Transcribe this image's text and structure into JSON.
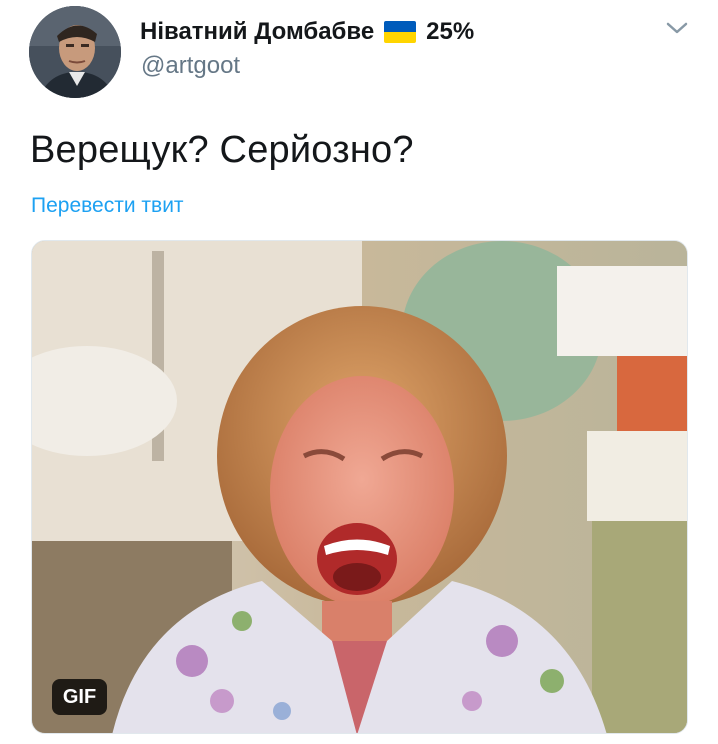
{
  "tweet": {
    "author": {
      "display_name": "Ніватний Домбабве",
      "flag_icon": "ukraine-flag-icon",
      "percent": "25%",
      "handle": "@artgoot"
    },
    "text": "Верещук? Серйозно?",
    "translate_label": "Перевести твит",
    "media": {
      "badge": "GIF",
      "description_icon": "laughing-woman-gif"
    },
    "menu_icon": "chevron-down-icon"
  },
  "colors": {
    "text": "#14171a",
    "secondary": "#657786",
    "link": "#1da1f2",
    "flag_blue": "#005bbb",
    "flag_yellow": "#ffd500"
  }
}
